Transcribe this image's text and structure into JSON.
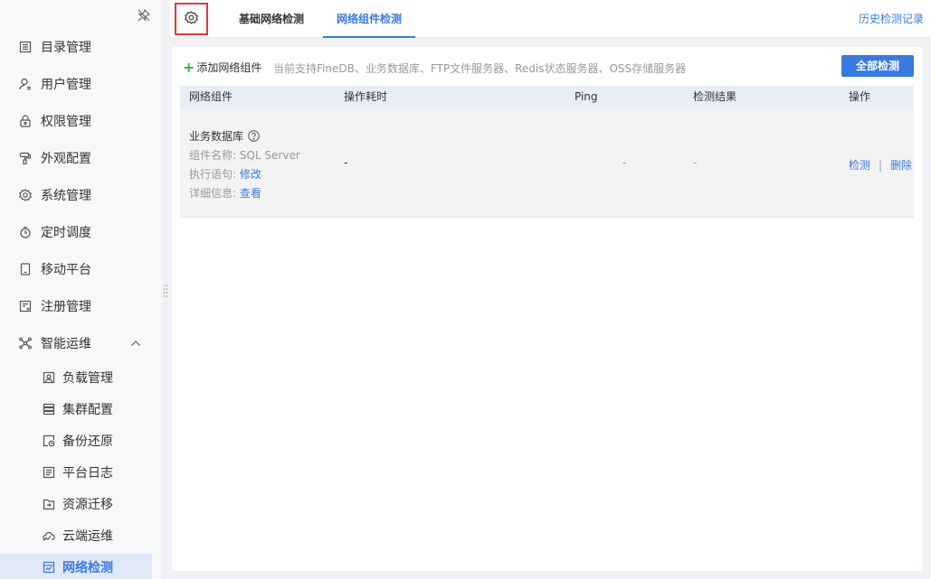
{
  "sidebar": {
    "items": [
      {
        "label": "目录管理",
        "icon": "catalog-icon"
      },
      {
        "label": "用户管理",
        "icon": "user-icon"
      },
      {
        "label": "权限管理",
        "icon": "lock-icon"
      },
      {
        "label": "外观配置",
        "icon": "paint-roller-icon"
      },
      {
        "label": "系统管理",
        "icon": "gear-icon"
      },
      {
        "label": "定时调度",
        "icon": "timer-icon"
      },
      {
        "label": "移动平台",
        "icon": "mobile-icon"
      },
      {
        "label": "注册管理",
        "icon": "register-icon"
      },
      {
        "label": "智能运维",
        "icon": "network-nodes-icon"
      }
    ],
    "sub_items": [
      {
        "label": "负载管理",
        "icon": "load-icon"
      },
      {
        "label": "集群配置",
        "icon": "cluster-icon"
      },
      {
        "label": "备份还原",
        "icon": "backup-icon"
      },
      {
        "label": "平台日志",
        "icon": "log-icon"
      },
      {
        "label": "资源迁移",
        "icon": "folder-migrate-icon"
      },
      {
        "label": "云端运维",
        "icon": "cloud-chart-icon"
      },
      {
        "label": "网络检测",
        "icon": "network-check-icon"
      }
    ]
  },
  "tabs": {
    "basic": "基础网络检测",
    "component": "网络组件检测",
    "history": "历史检测记录"
  },
  "toolbar": {
    "add_label": "添加网络组件",
    "hint": "当前支持FineDB、业务数据库、FTP文件服务器、Redis状态服务器、OSS存储服务器",
    "check_all_label": "全部检测"
  },
  "table": {
    "columns": [
      "网络组件",
      "操作耗时",
      "Ping",
      "检测结果",
      "操作"
    ],
    "rows": [
      {
        "component": "业务数据库",
        "name_label": "组件名称: ",
        "name_value": "SQL Server",
        "stmt_label": "执行语句: ",
        "stmt_link": "修改",
        "detail_label": "详细信息: ",
        "detail_link": "查看",
        "duration": "-",
        "ping": "-",
        "result": "-",
        "action_check": "检测",
        "action_sep": "|",
        "action_delete": "删除"
      }
    ]
  },
  "colors": {
    "accent": "#3a7ae0",
    "highlight_border": "#e03a3a",
    "add_plus": "#2fb34a"
  }
}
